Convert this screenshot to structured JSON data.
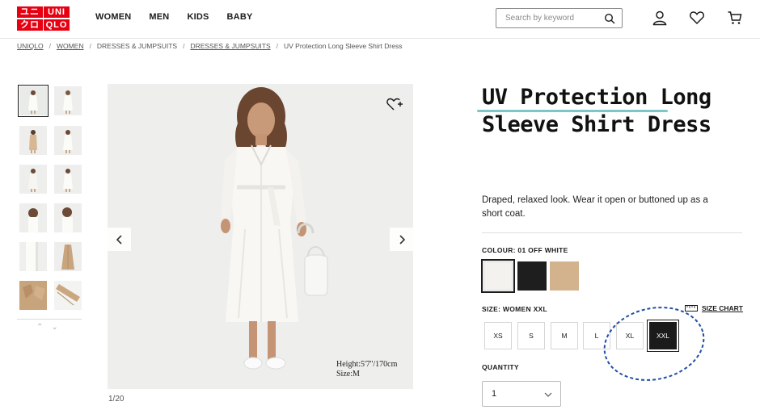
{
  "brand": {
    "logo_cells": [
      "ユニ",
      "UNI",
      "クロ",
      "QLO"
    ],
    "logo_color": "#e60012"
  },
  "nav": {
    "items": [
      "WOMEN",
      "MEN",
      "KIDS",
      "BABY"
    ]
  },
  "search": {
    "placeholder": "Search by keyword",
    "icon": "search-icon"
  },
  "header_icons": [
    "account-icon",
    "heart-icon",
    "cart-icon"
  ],
  "breadcrumb": [
    {
      "label": "UNIQLO",
      "link": true
    },
    {
      "label": "WOMEN",
      "link": true
    },
    {
      "label": "DRESSES & JUMPSUITS",
      "link": false
    },
    {
      "label": "DRESSES & JUMPSUITS",
      "link": true
    },
    {
      "label": "UV Protection Long Sleeve Shirt Dress",
      "link": false
    }
  ],
  "gallery": {
    "counter": "1/20",
    "model_info": [
      "Height:5'7''/170cm",
      "Size:M"
    ],
    "thumbnail_count": 12
  },
  "product": {
    "title_line1": "UV Protection Long",
    "title_line2": "Sleeve Shirt Dress",
    "description_line1": "Draped, relaxed look. Wear it open or buttoned up as a",
    "description_line2": "short coat.",
    "colour_label": "COLOUR: 01 OFF WHITE",
    "colours": [
      {
        "name": "OFF WHITE",
        "hex": "#f4f2ee"
      },
      {
        "name": "BLACK",
        "hex": "#1e1e1e"
      },
      {
        "name": "BEIGE",
        "hex": "#d2b38e"
      }
    ],
    "size_label": "SIZE: WOMEN XXL",
    "size_chart_label": "SIZE CHART",
    "sizes": [
      "XS",
      "S",
      "M",
      "L",
      "XL",
      "XXL"
    ],
    "selected_size": "XXL",
    "quantity_label": "QUANTITY",
    "quantity_value": "1"
  },
  "annotation": {
    "color": "#1f4fa8"
  }
}
